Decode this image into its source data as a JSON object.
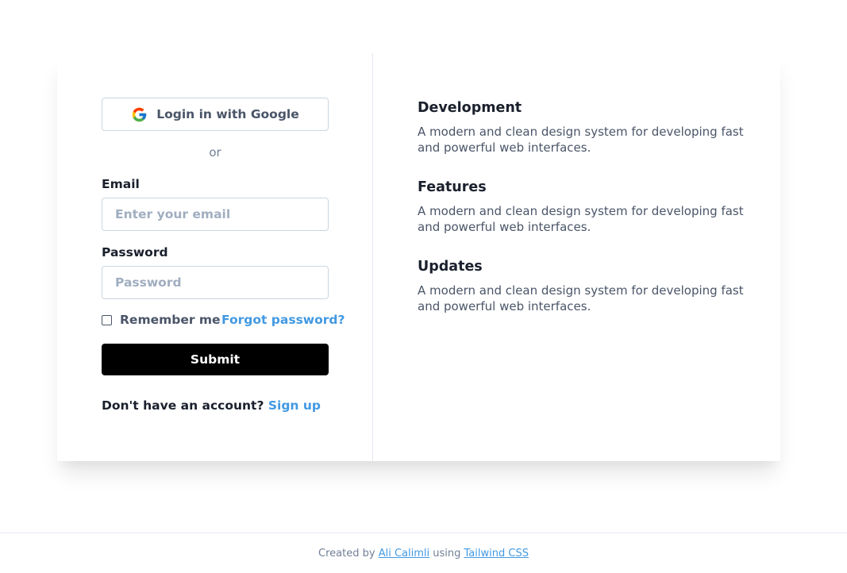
{
  "login": {
    "google_button_label": "Login in with Google",
    "or_text": "or",
    "email_label": "Email",
    "email_placeholder": "Enter your email",
    "password_label": "Password",
    "password_placeholder": "Password",
    "remember_label": "Remember me",
    "forgot_link": "Forgot password?",
    "submit_label": "Submit",
    "signup_prompt": "Don't have an account?",
    "signup_link": "Sign up"
  },
  "features": [
    {
      "title": "Development",
      "description": "A modern and clean design system for developing fast and powerful web interfaces."
    },
    {
      "title": "Features",
      "description": "A modern and clean design system for developing fast and powerful web interfaces."
    },
    {
      "title": "Updates",
      "description": "A modern and clean design system for developing fast and powerful web interfaces."
    }
  ],
  "footer": {
    "created_by": "Created by",
    "author": "Ali Calimli",
    "using": "using",
    "tool": "Tailwind CSS"
  },
  "colors": {
    "accent": "#4299e1",
    "submit_bg": "#000000",
    "border": "#cbd5e0"
  },
  "icons": {
    "google": "google-icon",
    "checkbox": "checkbox-unchecked"
  }
}
